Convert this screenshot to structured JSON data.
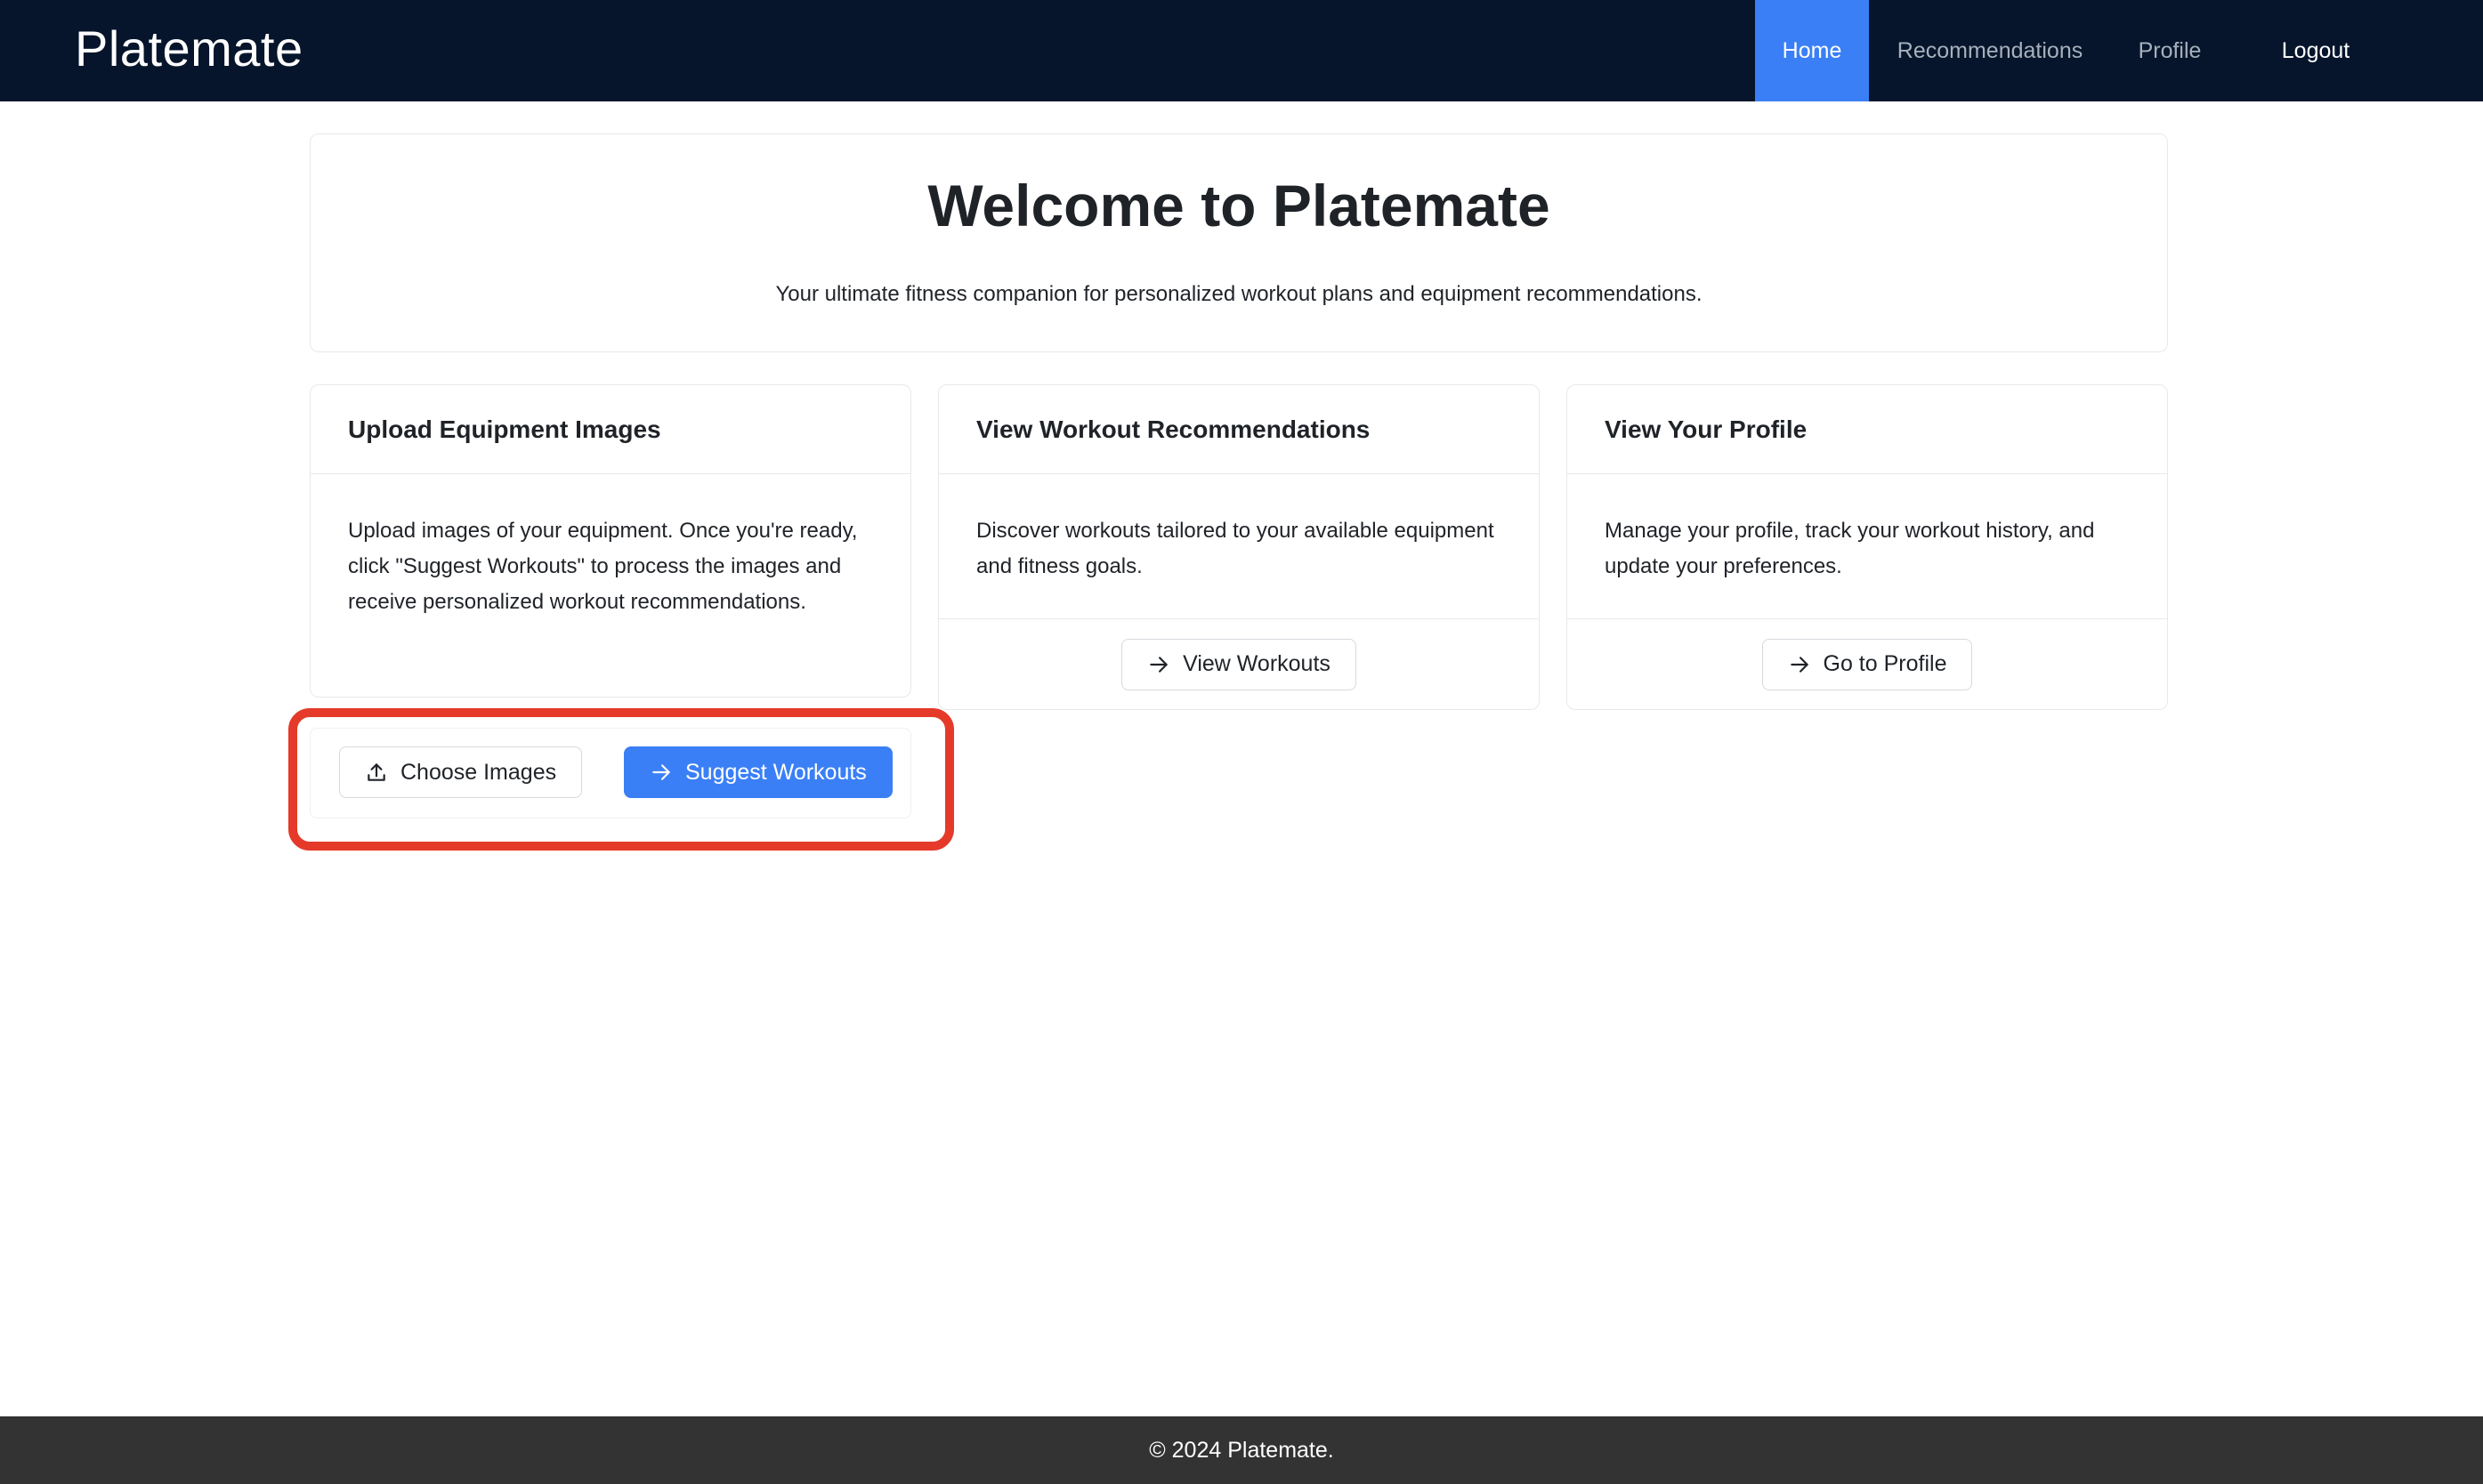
{
  "nav": {
    "brand": "Platemate",
    "items": [
      {
        "label": "Home",
        "active": true
      },
      {
        "label": "Recommendations"
      },
      {
        "label": "Profile"
      }
    ],
    "logout": "Logout"
  },
  "hero": {
    "title": "Welcome to Platemate",
    "subtitle": "Your ultimate fitness companion for personalized workout plans and equipment recommendations."
  },
  "cards": [
    {
      "title": "Upload Equipment Images",
      "body": "Upload images of your equipment. Once you're ready, click \"Suggest Workouts\" to process the images and receive personalized workout recommendations.",
      "actions": {
        "choose": "Choose Images",
        "suggest": "Suggest Workouts"
      }
    },
    {
      "title": "View Workout Recommendations",
      "body": "Discover workouts tailored to your available equipment and fitness goals.",
      "button": "View Workouts"
    },
    {
      "title": "View Your Profile",
      "body": "Manage your profile, track your workout history, and update your preferences.",
      "button": "Go to Profile"
    }
  ],
  "footer": {
    "text": "© 2024 Platemate."
  },
  "colors": {
    "navbar": "#06152b",
    "accent": "#3a7ff6",
    "highlight": "#e53a2a",
    "footer": "#333333"
  },
  "icons": {
    "upload": "upload-icon",
    "arrow": "arrow-right-icon"
  }
}
